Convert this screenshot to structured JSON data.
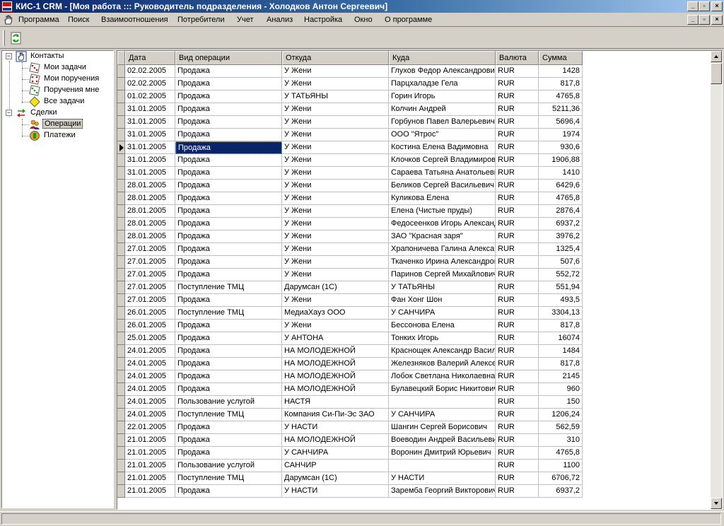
{
  "window": {
    "title": "КИС-1 CRM - [Моя работа ::: Руководитель подразделения - Холодков Антон Сергеевич]",
    "minimize": "_",
    "maximize": "▫",
    "close": "×"
  },
  "menu": [
    {
      "label": "Программа"
    },
    {
      "label": "Поиск"
    },
    {
      "label": "Взаимоотношения"
    },
    {
      "label": "Потребители"
    },
    {
      "label": "Учет"
    },
    {
      "label": "Анализ"
    },
    {
      "label": "Настройка"
    },
    {
      "label": "Окно"
    },
    {
      "label": "О программе"
    }
  ],
  "mdi": {
    "minimize": "_",
    "restore": "▫",
    "close": "×"
  },
  "toolbar": {
    "refresh_icon": "refresh-icon"
  },
  "tree": {
    "contacts": {
      "label": "Контакты",
      "expander": "−"
    },
    "my_tasks": {
      "label": "Мои задачи"
    },
    "my_assignments": {
      "label": "Мои поручения"
    },
    "assignments_to_me": {
      "label": "Поручения мне"
    },
    "all_tasks": {
      "label": "Все задачи"
    },
    "deals": {
      "label": "Сделки",
      "expander": "−"
    },
    "operations": {
      "label": "Операции",
      "selected": true
    },
    "payments": {
      "label": "Платежи"
    }
  },
  "grid": {
    "columns": [
      "Дата",
      "Вид операции",
      "Откуда",
      "Куда",
      "Валюта",
      "Сумма"
    ],
    "selected_row": 6,
    "rows": [
      [
        "02.02.2005",
        "Продажа",
        "У Жени",
        "Глухов Федор Александрович",
        "RUR",
        "1428"
      ],
      [
        "02.02.2005",
        "Продажа",
        "У Жени",
        "Парцхаладзе Гела",
        "RUR",
        "817,8"
      ],
      [
        "01.02.2005",
        "Продажа",
        "У ТАТЬЯНЫ",
        "Горин Игорь",
        "RUR",
        "4765,8"
      ],
      [
        "31.01.2005",
        "Продажа",
        "У Жени",
        "Колчин Андрей",
        "RUR",
        "5211,36"
      ],
      [
        "31.01.2005",
        "Продажа",
        "У Жени",
        "Горбунов Павел Валерьевич",
        "RUR",
        "5696,4"
      ],
      [
        "31.01.2005",
        "Продажа",
        "У Жени",
        "ООО \"Ятрос\"",
        "RUR",
        "1974"
      ],
      [
        "31.01.2005",
        "Продажа",
        "У Жени",
        "Костина Елена Вадимовна",
        "RUR",
        "930,6"
      ],
      [
        "31.01.2005",
        "Продажа",
        "У Жени",
        "Клочков Сергей Владимирович",
        "RUR",
        "1906,88"
      ],
      [
        "31.01.2005",
        "Продажа",
        "У Жени",
        "Сараева Татьяна Анатольевна",
        "RUR",
        "1410"
      ],
      [
        "28.01.2005",
        "Продажа",
        "У Жени",
        "Беликов Сергей Васильевич",
        "RUR",
        "6429,6"
      ],
      [
        "28.01.2005",
        "Продажа",
        "У Жени",
        "Куликова Елена",
        "RUR",
        "4765,8"
      ],
      [
        "28.01.2005",
        "Продажа",
        "У Жени",
        "Елена (Чистые пруды)",
        "RUR",
        "2876,4"
      ],
      [
        "28.01.2005",
        "Продажа",
        "У Жени",
        "Федосеенков Игорь Александрович",
        "RUR",
        "6937,2"
      ],
      [
        "28.01.2005",
        "Продажа",
        "У Жени",
        "ЗАО \"Красная заря\"",
        "RUR",
        "3976,2"
      ],
      [
        "27.01.2005",
        "Продажа",
        "У Жени",
        "Храпоничева Галина Александровна",
        "RUR",
        "1325,4"
      ],
      [
        "27.01.2005",
        "Продажа",
        "У Жени",
        "Ткаченко Ирина Александровна",
        "RUR",
        "507,6"
      ],
      [
        "27.01.2005",
        "Продажа",
        "У Жени",
        "Паринов Сергей Михайлович",
        "RUR",
        "552,72"
      ],
      [
        "27.01.2005",
        "Поступление ТМЦ",
        "Дарумсан (1С)",
        "У ТАТЬЯНЫ",
        "RUR",
        "551,94"
      ],
      [
        "27.01.2005",
        "Продажа",
        "У Жени",
        "Фан Хонг Шон",
        "RUR",
        "493,5"
      ],
      [
        "26.01.2005",
        "Поступление ТМЦ",
        "МедиаХауз ООО",
        "У САНЧИРА",
        "RUR",
        "3304,13"
      ],
      [
        "26.01.2005",
        "Продажа",
        "У Жени",
        "Бессонова Елена",
        "RUR",
        "817,8"
      ],
      [
        "25.01.2005",
        "Продажа",
        "У АНТОНА",
        "Тонких Игорь",
        "RUR",
        "16074"
      ],
      [
        "24.01.2005",
        "Продажа",
        "НА МОЛОДЕЖНОЙ",
        "Краснощек Александр Васильевич",
        "RUR",
        "1484"
      ],
      [
        "24.01.2005",
        "Продажа",
        "НА МОЛОДЕЖНОЙ",
        "Железняков Валерий Алексеевич",
        "RUR",
        "817,8"
      ],
      [
        "24.01.2005",
        "Продажа",
        "НА МОЛОДЕЖНОЙ",
        "Лобок Светлана Николаевна",
        "RUR",
        "2145"
      ],
      [
        "24.01.2005",
        "Продажа",
        "НА МОЛОДЕЖНОЙ",
        "Булавецкий Борис Никитович",
        "RUR",
        "960"
      ],
      [
        "24.01.2005",
        "Пользование услугой",
        "НАСТЯ",
        "",
        "RUR",
        "150"
      ],
      [
        "24.01.2005",
        "Поступление ТМЦ",
        "Компания Си-Пи-Эс ЗАО",
        "У САНЧИРА",
        "RUR",
        "1206,24"
      ],
      [
        "22.01.2005",
        "Продажа",
        "У НАСТИ",
        "Шангин Сергей Борисович",
        "RUR",
        "562,59"
      ],
      [
        "21.01.2005",
        "Продажа",
        "НА МОЛОДЕЖНОЙ",
        "Воеводин Андрей Васильевич",
        "RUR",
        "310"
      ],
      [
        "21.01.2005",
        "Продажа",
        "У САНЧИРА",
        "Воронин Дмитрий Юрьевич",
        "RUR",
        "4765,8"
      ],
      [
        "21.01.2005",
        "Пользование услугой",
        "САНЧИР",
        "",
        "RUR",
        "1100"
      ],
      [
        "21.01.2005",
        "Поступление ТМЦ",
        "Дарумсан (1С)",
        "У НАСТИ",
        "RUR",
        "6706,72"
      ],
      [
        "21.01.2005",
        "Продажа",
        "У НАСТИ",
        "Заремба Георгий Викторович",
        "RUR",
        "6937,2"
      ]
    ]
  },
  "colors": {
    "title_start": "#0a246a",
    "title_end": "#a6caf0",
    "selection": "#0a246a",
    "face": "#d4d0c8"
  }
}
